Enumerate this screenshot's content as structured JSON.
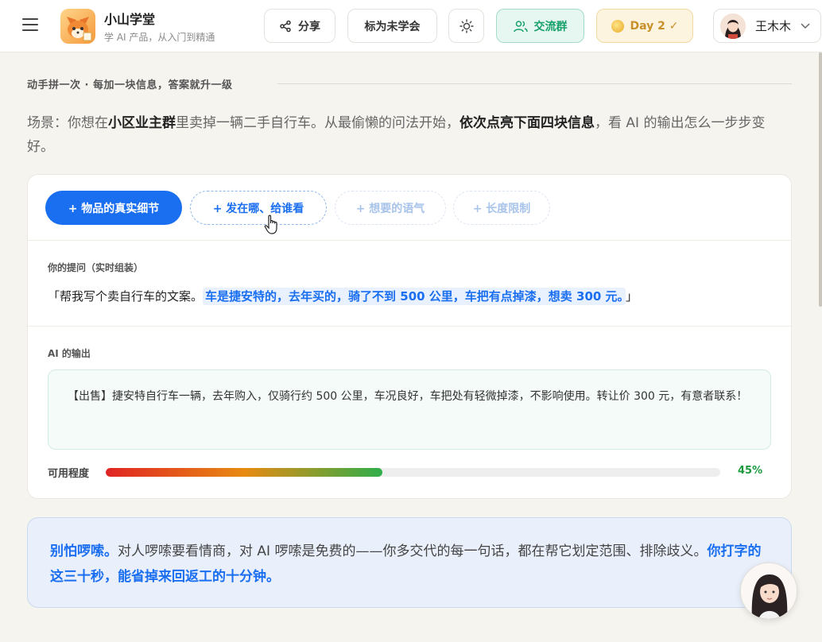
{
  "header": {
    "brand_title": "小山学堂",
    "brand_subtitle": "学 AI 产品，从入门到精通",
    "share_label": "分享",
    "mark_label": "标为未学会",
    "group_label": "交流群",
    "day_label": "Day 2 ✓",
    "user_name": "王木木"
  },
  "section": {
    "label": "动手拼一次 · 每加一块信息，答案就升一级",
    "scenario": {
      "p1": "场景：你想在",
      "b1": "小区业主群",
      "p2": "里卖掉一辆二手自行车。从最偷懒的问法开始，",
      "b2": "依次点亮下面四块信息",
      "p3": "，看 AI 的输出怎么一步步变好。"
    }
  },
  "pills": [
    {
      "label": "+ 物品的真实细节",
      "state": "active"
    },
    {
      "label": "+ 发在哪、给谁看",
      "state": "hover"
    },
    {
      "label": "+ 想要的语气",
      "state": "disabled"
    },
    {
      "label": "+ 长度限制",
      "state": "disabled"
    }
  ],
  "prompt": {
    "label": "你的提问（实时组装）",
    "open_quote": "「",
    "base": "帮我写个卖自行车的文案。",
    "highlight": "车是捷安特的，去年买的，骑了不到 500 公里，车把有点掉漆，想卖 300 元。",
    "close_quote": "」"
  },
  "output": {
    "label": "AI 的输出",
    "text": "【出售】捷安特自行车一辆，去年购入，仅骑行约 500 公里，车况良好，车把处有轻微掉漆，不影响使用。转让价 300 元，有意者联系！"
  },
  "usability": {
    "label": "可用程度",
    "value": 45,
    "value_text": "45%"
  },
  "tip": {
    "b1": "别怕啰嗦。",
    "p1": "对人啰嗦要看情商，对 AI 啰嗦是免费的——你多交代的每一句话，都在帮它划定范围、排除歧义。",
    "b2": "你打字的这三十秒，能省掉来回返工的十分钟。"
  },
  "colors": {
    "accent": "#1a6ef0",
    "success": "#1c9a3d",
    "group_green": "#18a06b",
    "gold": "#c8902a"
  },
  "icons": [
    "menu-icon",
    "share-icon",
    "sun-icon",
    "users-icon",
    "coin-icon",
    "chevron-down-icon",
    "hand-cursor-icon"
  ]
}
